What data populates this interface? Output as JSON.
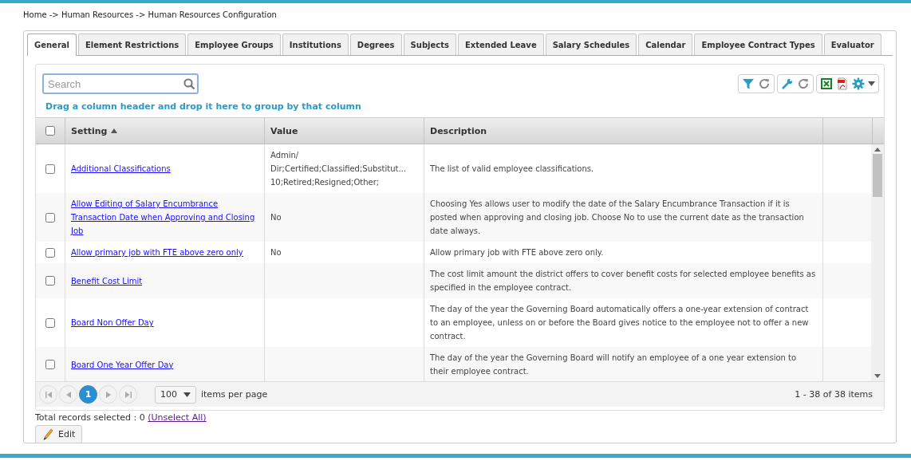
{
  "breadcrumb": "Home -> Human Resources -> Human Resources Configuration",
  "tabs": [
    {
      "label": "General",
      "selected": true
    },
    {
      "label": "Element Restrictions",
      "selected": false
    },
    {
      "label": "Employee Groups",
      "selected": false
    },
    {
      "label": "Institutions",
      "selected": false
    },
    {
      "label": "Degrees",
      "selected": false
    },
    {
      "label": "Subjects",
      "selected": false
    },
    {
      "label": "Extended Leave",
      "selected": false
    },
    {
      "label": "Salary Schedules",
      "selected": false
    },
    {
      "label": "Calendar",
      "selected": false
    },
    {
      "label": "Employee Contract Types",
      "selected": false
    },
    {
      "label": "Evaluator",
      "selected": false
    }
  ],
  "search": {
    "placeholder": "Search"
  },
  "group_hint": "Drag a column header and drop it here to group by that column",
  "table": {
    "select_all_checked": false,
    "columns": [
      {
        "label": "Setting",
        "sorted": true
      },
      {
        "label": "Value",
        "sorted": false
      },
      {
        "label": "Description",
        "sorted": false
      }
    ],
    "rows": [
      {
        "checked": false,
        "setting": "Additional Classifications",
        "value_lines": [
          "Admin/",
          "Dir;Certified;Classified;Substitut...",
          "10;Retired;Resigned;Other;"
        ],
        "description": "The list of valid employee classifications."
      },
      {
        "checked": false,
        "setting": "Allow Editing of Salary Encumbrance Transaction Date when Approving and Closing Job",
        "value_lines": [
          "No"
        ],
        "description": "Choosing Yes allows user to modify the date of the Salary Encumbrance Transaction if it is posted when approving and closing job. Choose No to use the current date as the transaction date always."
      },
      {
        "checked": false,
        "setting": "Allow primary job with FTE above zero only",
        "value_lines": [
          "No"
        ],
        "description": "Allow primary job with FTE above zero only."
      },
      {
        "checked": false,
        "setting": "Benefit Cost Limit",
        "value_lines": [],
        "description": "The cost limit amount the district offers to cover benefit costs for selected employee benefits as specified in the employee contract."
      },
      {
        "checked": false,
        "setting": "Board Non Offer Day",
        "value_lines": [],
        "description": "The day of the year the Governing Board automatically offers a one-year extension of contract to an employee, unless on or before the Board gives notice to the employee not to offer a new contract."
      },
      {
        "checked": false,
        "setting": "Board One Year Offer Day",
        "value_lines": [],
        "description": "The day of the year the Governing Board will notify an employee of a one year extension to their employee contract."
      }
    ]
  },
  "pager": {
    "pages": [
      {
        "label": "1",
        "selected": true
      }
    ],
    "page_size": "100",
    "page_size_label": "items per page",
    "summary": "1 - 38 of 38 items"
  },
  "selection": {
    "text": "Total records selected : 0",
    "link": "(Unselect All)"
  },
  "edit_button": "Edit"
}
